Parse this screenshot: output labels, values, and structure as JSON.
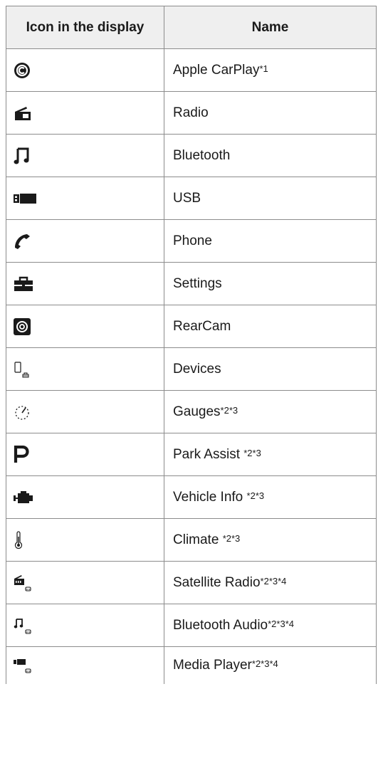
{
  "table": {
    "header": {
      "icon_col": "Icon in the display",
      "name_col": "Name"
    },
    "rows": [
      {
        "icon": "carplay-icon",
        "name": "Apple CarPlay",
        "notes": "*1"
      },
      {
        "icon": "radio-icon",
        "name": "Radio",
        "notes": ""
      },
      {
        "icon": "music-note-icon",
        "name": "Bluetooth",
        "notes": ""
      },
      {
        "icon": "usb-icon",
        "name": "USB",
        "notes": ""
      },
      {
        "icon": "phone-icon",
        "name": "Phone",
        "notes": ""
      },
      {
        "icon": "toolbox-icon",
        "name": "Settings",
        "notes": ""
      },
      {
        "icon": "rear-camera-icon",
        "name": "RearCam",
        "notes": ""
      },
      {
        "icon": "devices-icon",
        "name": "Devices",
        "notes": ""
      },
      {
        "icon": "gauge-icon",
        "name": "Gauges",
        "notes": "*2*3"
      },
      {
        "icon": "park-p-icon",
        "name": "Park Assist ",
        "notes": "*2*3"
      },
      {
        "icon": "engine-icon",
        "name": "Vehicle Info ",
        "notes": "*2*3"
      },
      {
        "icon": "thermometer-icon",
        "name": "Climate ",
        "notes": "*2*3"
      },
      {
        "icon": "satellite-radio-icon",
        "name": "Satellite Radio",
        "notes": "*2*3*4"
      },
      {
        "icon": "bluetooth-audio-icon",
        "name": "Bluetooth Audio",
        "notes": "*2*3*4"
      },
      {
        "icon": "media-player-icon",
        "name": "Media Player",
        "notes": "*2*3*4"
      }
    ]
  }
}
